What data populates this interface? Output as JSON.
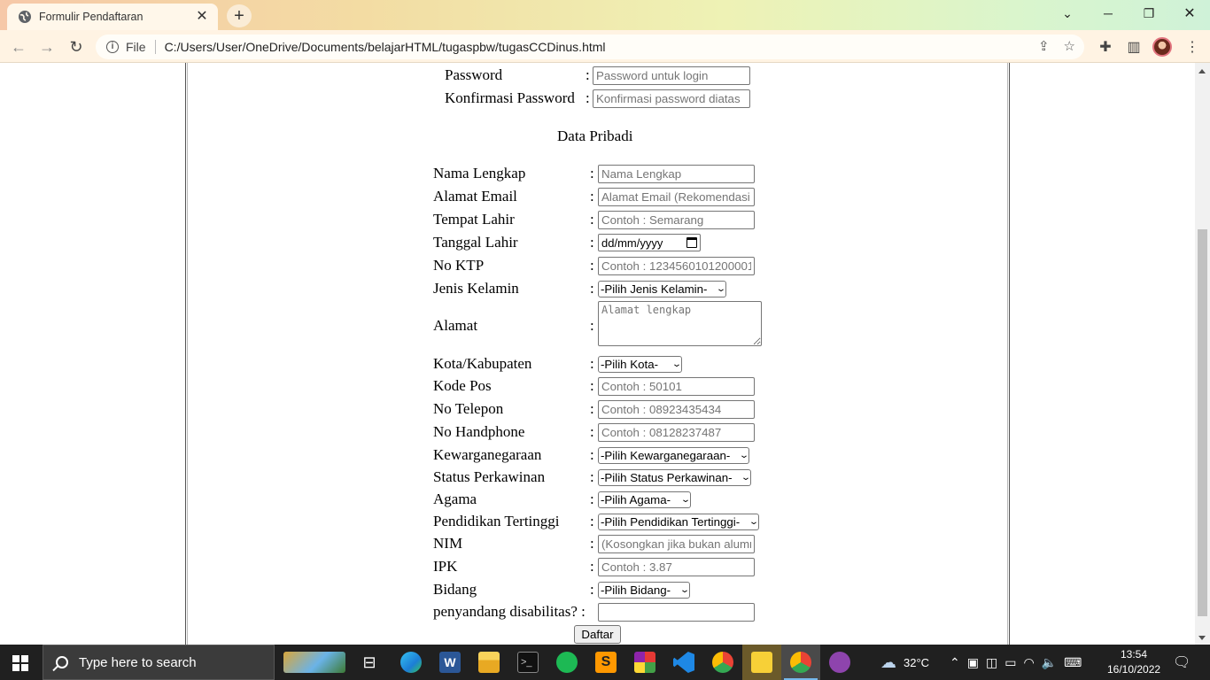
{
  "browser": {
    "tab_title": "Formulir Pendaftaran",
    "scheme_label": "File",
    "url": "C:/Users/User/OneDrive/Documents/belajarHTML/tugaspbw/tugasCCDinus.html"
  },
  "form": {
    "password": {
      "label": "Password",
      "placeholder": "Password untuk login"
    },
    "confirm_password": {
      "label": "Konfirmasi Password",
      "placeholder": "Konfirmasi password diatas"
    },
    "section_title": "Data Pribadi",
    "colon": ":",
    "nama": {
      "label": "Nama Lengkap",
      "placeholder": "Nama Lengkap"
    },
    "email": {
      "label": "Alamat Email",
      "placeholder": "Alamat Email (Rekomendasi"
    },
    "tempat_lahir": {
      "label": "Tempat Lahir",
      "placeholder": "Contoh : Semarang"
    },
    "tanggal_lahir": {
      "label": "Tanggal Lahir",
      "value": "dd/mm/yyyy"
    },
    "ktp": {
      "label": "No KTP",
      "placeholder": "Contoh : 1234560101200001"
    },
    "jenis_kelamin": {
      "label": "Jenis Kelamin",
      "selected": "-Pilih Jenis Kelamin-"
    },
    "alamat": {
      "label": "Alamat",
      "placeholder": "Alamat lengkap"
    },
    "kota": {
      "label": "Kota/Kabupaten",
      "selected": "-Pilih Kota-"
    },
    "kode_pos": {
      "label": "Kode Pos",
      "placeholder": "Contoh : 50101"
    },
    "telepon": {
      "label": "No Telepon",
      "placeholder": "Contoh : 08923435434"
    },
    "handphone": {
      "label": "No Handphone",
      "placeholder": "Contoh : 08128237487"
    },
    "kewarganegaraan": {
      "label": "Kewarganegaraan",
      "selected": "-Pilih Kewarganegaraan-"
    },
    "status": {
      "label": "Status Perkawinan",
      "selected": "-Pilih Status Perkawinan-"
    },
    "agama": {
      "label": "Agama",
      "selected": "-Pilih Agama-"
    },
    "pendidikan": {
      "label": "Pendidikan Tertinggi",
      "selected": "-Pilih Pendidikan Tertinggi-"
    },
    "nim": {
      "label": "NIM",
      "placeholder": "(Kosongkan jika bukan alumni"
    },
    "ipk": {
      "label": "IPK",
      "placeholder": "Contoh : 3.87"
    },
    "bidang": {
      "label": "Bidang",
      "selected": "-Pilih Bidang-"
    },
    "disabilitas": {
      "label": "penyandang disabilitas? :",
      "value": ""
    },
    "submit_label": "Daftar"
  },
  "taskbar": {
    "search_placeholder": "Type here to search",
    "temperature": "32°C",
    "time": "13:54",
    "date": "16/10/2022"
  },
  "colors": {
    "taskbar_bg": "#202020",
    "toolbar_bg": "#fff3e3",
    "accent_underline": "#76b9ed"
  }
}
